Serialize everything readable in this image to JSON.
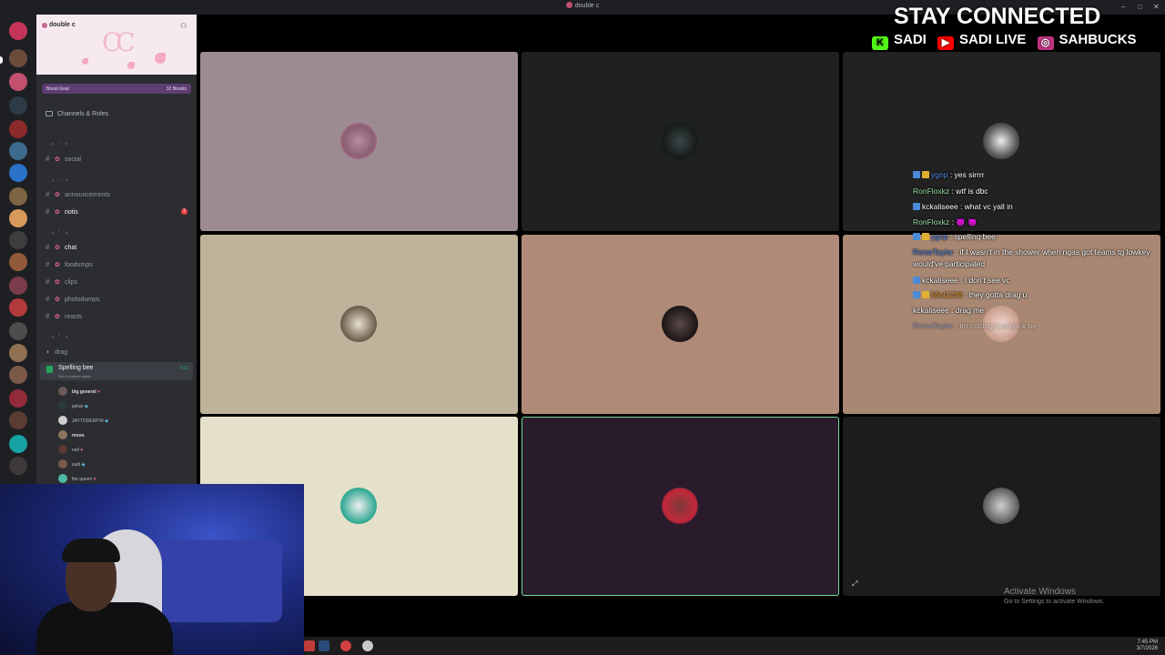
{
  "window": {
    "title": "double c"
  },
  "server": {
    "name": "double c",
    "boost_goal": "Boost Goal",
    "boost_count": "32 Boosts",
    "channels_roles": "Channels & Roles"
  },
  "channels": [
    {
      "label": "social"
    },
    {
      "label": "announcements"
    },
    {
      "label": "notis",
      "mention": "1"
    },
    {
      "label": "chat"
    },
    {
      "label": "foodumps"
    },
    {
      "label": "clips"
    },
    {
      "label": "photodumps"
    },
    {
      "label": "reacts"
    }
  ],
  "voice": {
    "drag_label": "drag",
    "channel_name": "Spelling bee",
    "status": "Set a channel status",
    "time": "4:53",
    "members": [
      {
        "name": "big general"
      },
      {
        "name": "jamar"
      },
      {
        "name": "JAYTODEEP34"
      },
      {
        "name": "mooo"
      },
      {
        "name": "nell"
      },
      {
        "name": "sadi"
      },
      {
        "name": "the queen"
      }
    ]
  },
  "chat_messages": [
    {
      "user": "ygnp",
      "text": ": yes sirrrr",
      "user_color": "#5b8def"
    },
    {
      "user": "RonFloxkz",
      "text": ": wtf is dbc",
      "user_color": "#9be0a3"
    },
    {
      "user": "kckaliseee",
      "text": ": what vc yall in",
      "user_color": "#ffffff"
    },
    {
      "user": "RonFloxkz",
      "text": ": 😈 😈",
      "user_color": "#9be0a3"
    },
    {
      "user": "ygnp",
      "text": ": spelling bee",
      "user_color": "#5b8def"
    },
    {
      "user": "RonwTaylor",
      "text": ": if I wasn't in the shower when ngas got teams tg lowkey would've participated",
      "user_color": "#5b8def"
    },
    {
      "user": "kckaliseee",
      "text": ": I don't see vc",
      "user_color": "#ffffff"
    },
    {
      "user": "Mini1238",
      "text": ": they gotta drag u",
      "user_color": "#f0a030"
    },
    {
      "user": "kckaliseee",
      "text": ": drag me",
      "user_color": "#ffffff"
    },
    {
      "user": "RonwTaylor",
      "text": ": im cutting him back be",
      "user_color": "#5b8def"
    }
  ],
  "overlay": {
    "headline": "STAY CONNECTED",
    "kick": "SADI",
    "youtube": "SADI LIVE",
    "instagram": "SAHBUCKS"
  },
  "watermark": {
    "line1": "Activate Windows",
    "line2": "Go to Settings to activate Windows."
  },
  "tray": {
    "time": "7:45 PM",
    "date": "3/7/2026"
  },
  "colors": {
    "tiles": [
      "#9d8b92",
      "#1e211f",
      "#222222",
      "#c0b39b",
      "#b08a78",
      "#a98873",
      "#e5e0c9",
      "#2a1b2c",
      "#1c1c1c"
    ],
    "accent_speaking": "#6fd89a"
  }
}
